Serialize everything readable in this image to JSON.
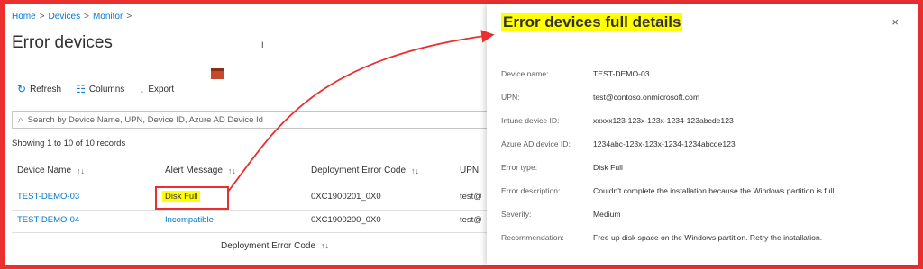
{
  "breadcrumb": [
    "Home",
    "Devices",
    "Monitor"
  ],
  "page_title": "Error devices",
  "cursor_glyph": "I",
  "toolbar": {
    "refresh": "Refresh",
    "columns": "Columns",
    "export": "Export"
  },
  "search": {
    "placeholder": "Search by Device Name, UPN, Device ID, Azure AD Device Id"
  },
  "showing": "Showing 1 to 10 of 10 records",
  "table": {
    "columns": [
      "Device Name",
      "Alert Message",
      "Deployment Error Code",
      "UPN"
    ],
    "rows": [
      {
        "device": "TEST-DEMO-03",
        "alert": "Disk Full",
        "code": "0XC1900201_0X0",
        "upn": "test@"
      },
      {
        "device": "TEST-DEMO-04",
        "alert": "Incompatible",
        "code": "0XC1900200_0X0",
        "upn": "test@"
      }
    ],
    "footer_column": "Deployment Error Code"
  },
  "panel": {
    "title": "Error devices full details",
    "close": "×",
    "details": [
      {
        "label": "Device name:",
        "value": "TEST-DEMO-03"
      },
      {
        "label": "UPN:",
        "value": "test@contoso.onmicrosoft.com"
      },
      {
        "label": "Intune device ID:",
        "value": "xxxxx123-123x-123x-1234-123abcde123"
      },
      {
        "label": "Azure AD device ID:",
        "value": "1234abc-123x-123x-1234-1234abcde123"
      },
      {
        "label": "Error type:",
        "value": "Disk Full"
      },
      {
        "label": "Error description:",
        "value": "Couldn't complete the installation because the Windows partition is full."
      },
      {
        "label": "Severity:",
        "value": "Medium"
      },
      {
        "label": "Recommendation:",
        "value": "Free up disk space on the Windows partition. Retry the installation."
      }
    ]
  },
  "colors": {
    "frame": "#e9302f",
    "highlight": "#ffff00",
    "link": "#0078d4"
  },
  "icons": {
    "refresh": "refresh-icon",
    "columns": "columns-icon",
    "export": "download-icon",
    "search": "search-icon",
    "sort": "sort-icon",
    "close": "close-icon"
  }
}
